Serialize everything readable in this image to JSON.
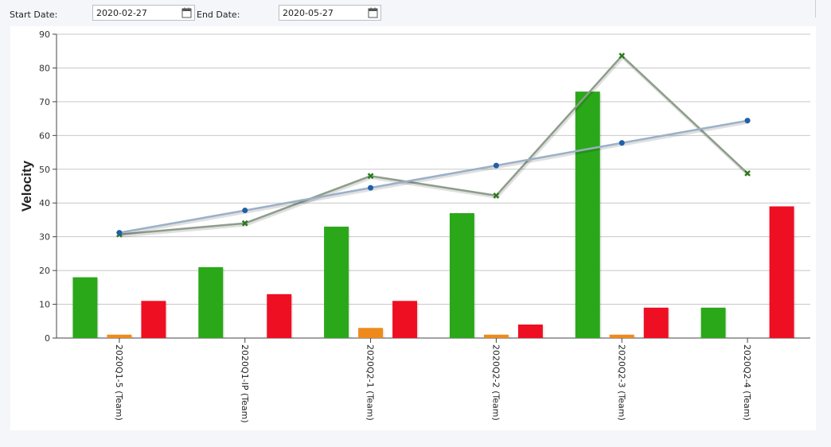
{
  "filters": {
    "start_label": "Start Date:",
    "start_value": "2020-02-27",
    "end_label": "End Date:",
    "end_value": "2020-05-27",
    "calendar_icon": "calendar-icon"
  },
  "chart_data": {
    "type": "bar",
    "ylabel": "Velocity",
    "xlabel": "",
    "ylim": [
      0,
      90
    ],
    "yticks": [
      0,
      10,
      20,
      30,
      40,
      50,
      60,
      70,
      80,
      90
    ],
    "grid": true,
    "legend": "none",
    "categories": [
      "2020Q1-5 (Team)",
      "2020Q1-IP (Team)",
      "2020Q2-1 (Team)",
      "2020Q2-2 (Team)",
      "2020Q2-3 (Team)",
      "2020Q2-4 (Team)"
    ],
    "series": [
      {
        "kind": "bar",
        "color": "#2aa81a",
        "values": [
          18,
          21,
          33,
          37,
          73,
          9
        ]
      },
      {
        "kind": "bar",
        "color": "#ee8a1c",
        "values": [
          1,
          0,
          3,
          1,
          1,
          0
        ]
      },
      {
        "kind": "bar",
        "color": "#ee0f23",
        "values": [
          11,
          13,
          11,
          4,
          9,
          39
        ]
      },
      {
        "kind": "line",
        "color": "#8d9d8a",
        "marker": "x",
        "marker_color": "#2d7a1f",
        "values": [
          30.7,
          34,
          48,
          42.2,
          83.6,
          48.8
        ]
      },
      {
        "kind": "line",
        "color": "#9ab0c8",
        "marker": "dot",
        "marker_color": "#1f5fa8",
        "values": [
          31.2,
          37.8,
          44.5,
          51.1,
          57.8,
          64.4
        ]
      }
    ]
  }
}
